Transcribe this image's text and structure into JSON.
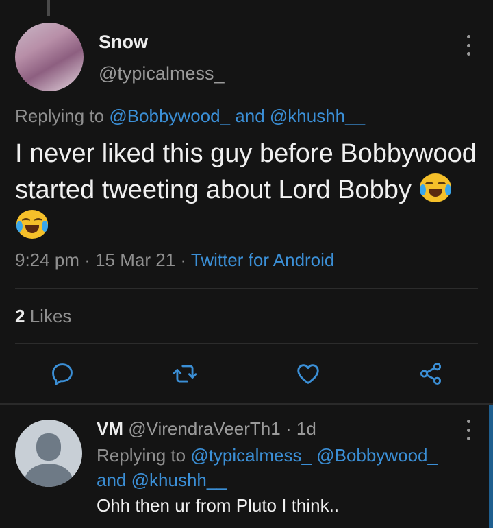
{
  "main_tweet": {
    "display_name": "Snow",
    "handle": "@typicalmess_",
    "replying_prefix": "Replying to",
    "replying_mentions": [
      "@Bobbywood_",
      "@khushh__"
    ],
    "replying_and": "and",
    "text": "I never liked this guy before Bobbywood started tweeting about Lord Bobby",
    "emojis": [
      "face-with-tears-of-joy",
      "face-with-tears-of-joy"
    ],
    "time": "9:24 pm",
    "date": "15 Mar 21",
    "separator": "·",
    "source": "Twitter for Android",
    "likes_count": "2",
    "likes_label": "Likes",
    "actions": [
      "reply-icon",
      "retweet-icon",
      "like-icon",
      "share-icon"
    ]
  },
  "reply_tweet": {
    "display_name": "VM",
    "handle": "@VirendraVeerTh1",
    "separator": "·",
    "age": "1d",
    "replying_prefix": "Replying to",
    "replying_mentions": [
      "@typicalmess_",
      "@Bobbywood_",
      "@khushh__"
    ],
    "replying_and": "and",
    "text": "Ohh then ur from Pluto I think.."
  },
  "colors": {
    "background": "#141414",
    "link": "#3b8fd6",
    "muted": "#8f8f8f"
  }
}
